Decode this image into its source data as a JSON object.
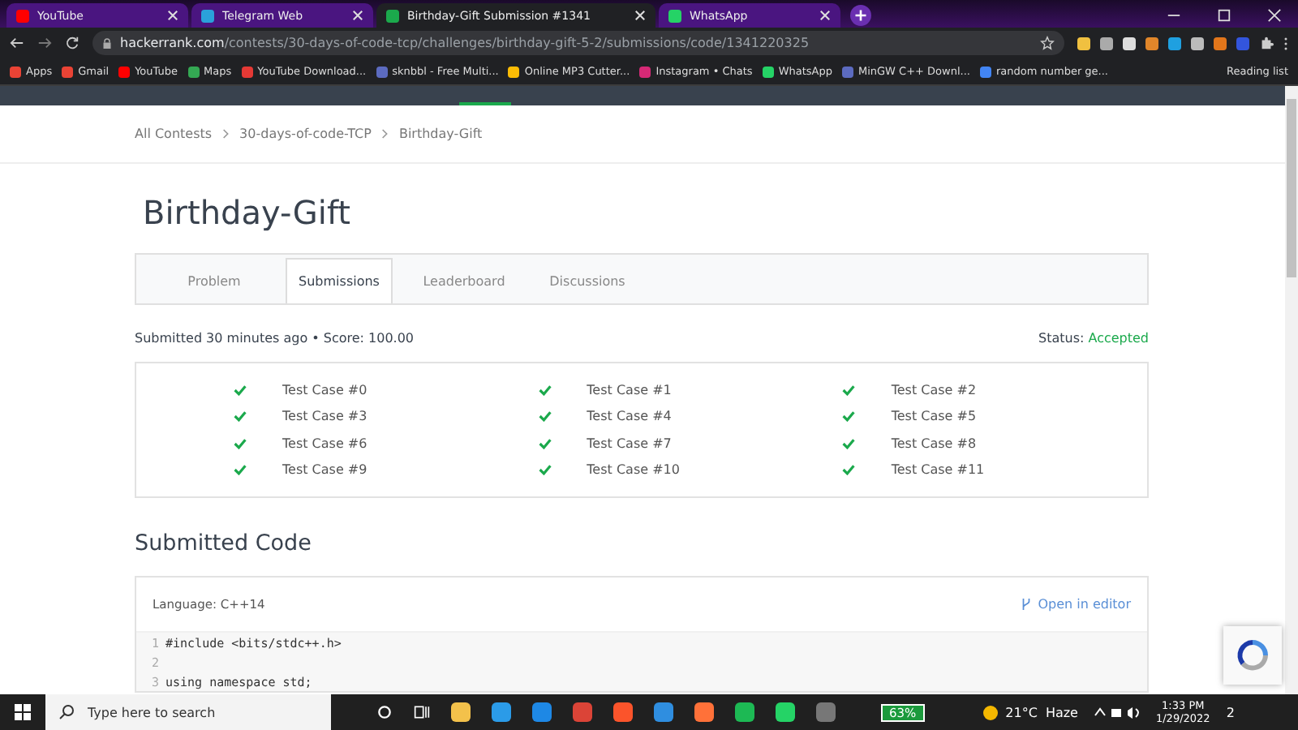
{
  "browser": {
    "tabs": [
      {
        "title": "YouTube",
        "kind": "youtube",
        "selected": false
      },
      {
        "title": "Telegram Web",
        "kind": "telegram",
        "selected": false
      },
      {
        "title": "Birthday-Gift Submission #1341",
        "kind": "hackerrank",
        "selected": true
      },
      {
        "title": "WhatsApp",
        "kind": "whatsapp",
        "selected": false
      }
    ],
    "url": {
      "host": "hackerrank.com",
      "path": "/contests/30-days-of-code-tcp/challenges/birthday-gift-5-2/submissions/code/1341220325"
    },
    "bookmarks": [
      {
        "label": "Apps",
        "kind": "apps"
      },
      {
        "label": "Gmail",
        "kind": "gmail"
      },
      {
        "label": "YouTube",
        "kind": "youtube"
      },
      {
        "label": "Maps",
        "kind": "maps"
      },
      {
        "label": "YouTube Download...",
        "kind": "download"
      },
      {
        "label": "sknbbl - Free Multi...",
        "kind": "generic"
      },
      {
        "label": "Online MP3 Cutter...",
        "kind": "dots"
      },
      {
        "label": "Instagram • Chats",
        "kind": "instagram"
      },
      {
        "label": "WhatsApp",
        "kind": "whatsapp"
      },
      {
        "label": "MinGW C++ Downl...",
        "kind": "generic"
      },
      {
        "label": "random number ge...",
        "kind": "google"
      }
    ],
    "reading_list": "Reading list"
  },
  "breadcrumb": [
    "All Contests",
    "30-days-of-code-TCP",
    "Birthday-Gift"
  ],
  "title": "Birthday-Gift",
  "tabs": [
    {
      "label": "Problem",
      "selected": false
    },
    {
      "label": "Submissions",
      "selected": true
    },
    {
      "label": "Leaderboard",
      "selected": false
    },
    {
      "label": "Discussions",
      "selected": false
    }
  ],
  "submission": {
    "info": "Submitted 30 minutes ago • Score: 100.00",
    "status_label": "Status:",
    "status": "Accepted"
  },
  "test_cases": [
    {
      "label": "Test Case #0",
      "passed": true
    },
    {
      "label": "Test Case #1",
      "passed": true
    },
    {
      "label": "Test Case #2",
      "passed": true
    },
    {
      "label": "Test Case #3",
      "passed": true
    },
    {
      "label": "Test Case #4",
      "passed": true
    },
    {
      "label": "Test Case #5",
      "passed": true
    },
    {
      "label": "Test Case #6",
      "passed": true
    },
    {
      "label": "Test Case #7",
      "passed": true
    },
    {
      "label": "Test Case #8",
      "passed": true
    },
    {
      "label": "Test Case #9",
      "passed": true
    },
    {
      "label": "Test Case #10",
      "passed": true
    },
    {
      "label": "Test Case #11",
      "passed": true
    }
  ],
  "code_section": {
    "heading": "Submitted Code",
    "language": "Language: C++14",
    "open_editor": "Open in editor",
    "lines": [
      {
        "number": "1",
        "code": "#include <bits/stdc++.h>"
      },
      {
        "number": "2"
      },
      {
        "number": "3",
        "code": "using namespace std;"
      }
    ]
  },
  "taskbar": {
    "search_placeholder": "Type here to search",
    "battery": "63%",
    "temperature": "21°C",
    "weather": "Haze",
    "time": "1:33 PM",
    "date": "1/29/2022",
    "notifications": "2"
  }
}
